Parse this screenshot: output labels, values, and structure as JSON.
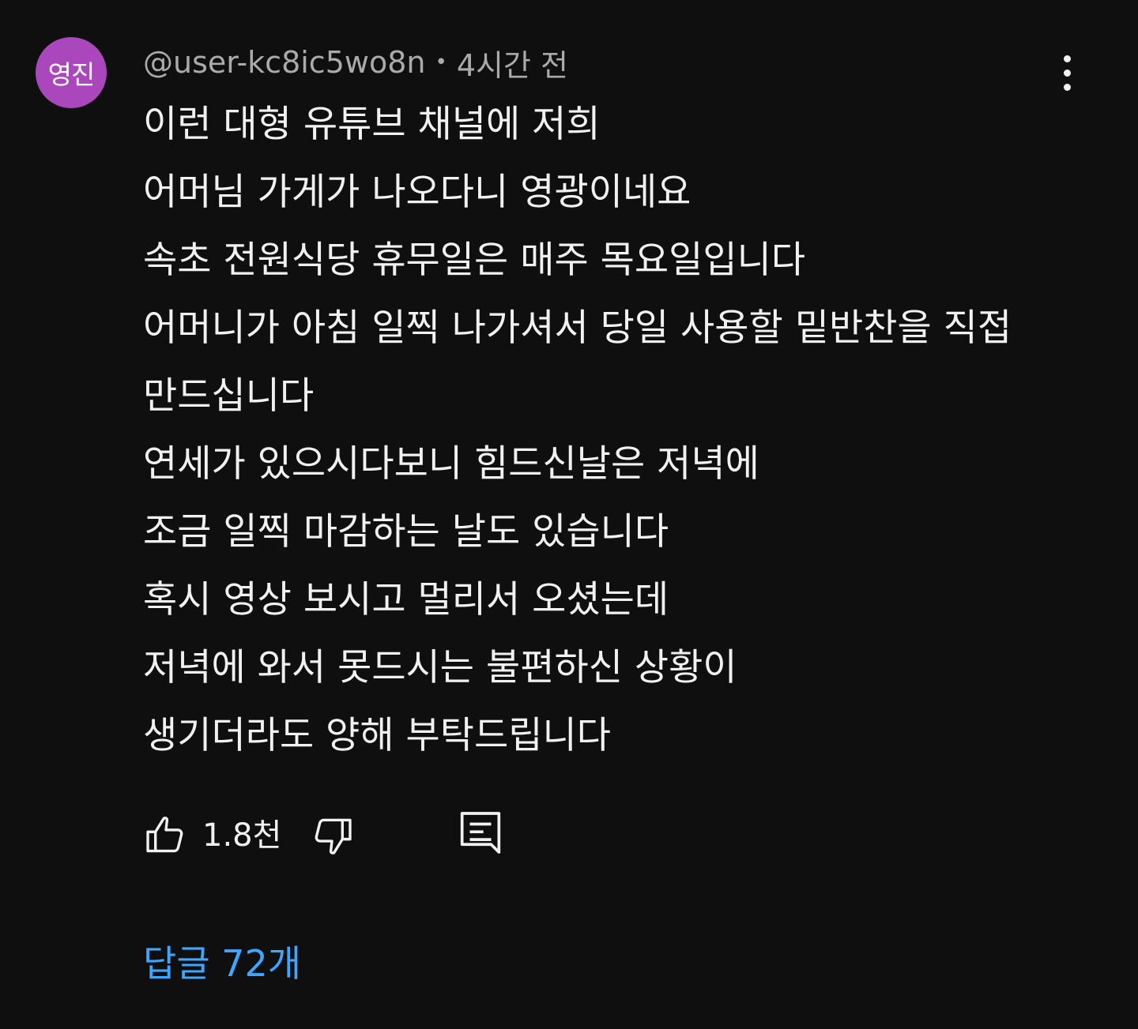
{
  "comment": {
    "avatar_text": "영진",
    "avatar_color": "#ab47bc",
    "author": "@user-kc8ic5wo8n",
    "separator": "•",
    "timestamp": "4시간 전",
    "menu_icon": "more-vertical-icon",
    "lines": [
      "이런 대형 유튜브 채널에 저희",
      "어머님 가게가 나오다니 영광이네요",
      "속초 전원식당 휴무일은 매주 목요일입니다",
      "어머니가 아침 일찍 나가셔서 당일 사용할 밑반찬을 직접",
      "만드십니다",
      "연세가 있으시다보니 힘드신날은 저녁에",
      "조금 일찍 마감하는 날도 있습니다",
      "혹시 영상 보시고 멀리서 오셨는데",
      "저녁에 와서 못드시는 불편하신 상황이",
      "생기더라도 양해 부탁드립니다"
    ],
    "actions": {
      "like_icon": "thumbs-up-icon",
      "like_count": "1.8천",
      "dislike_icon": "thumbs-down-icon",
      "reply_icon": "reply-comment-icon"
    },
    "replies_label": "답글 72개",
    "colors": {
      "background": "#0f0f0f",
      "text": "#f1f1f1",
      "meta": "#aaaaaa",
      "link": "#3ea6ff"
    }
  }
}
